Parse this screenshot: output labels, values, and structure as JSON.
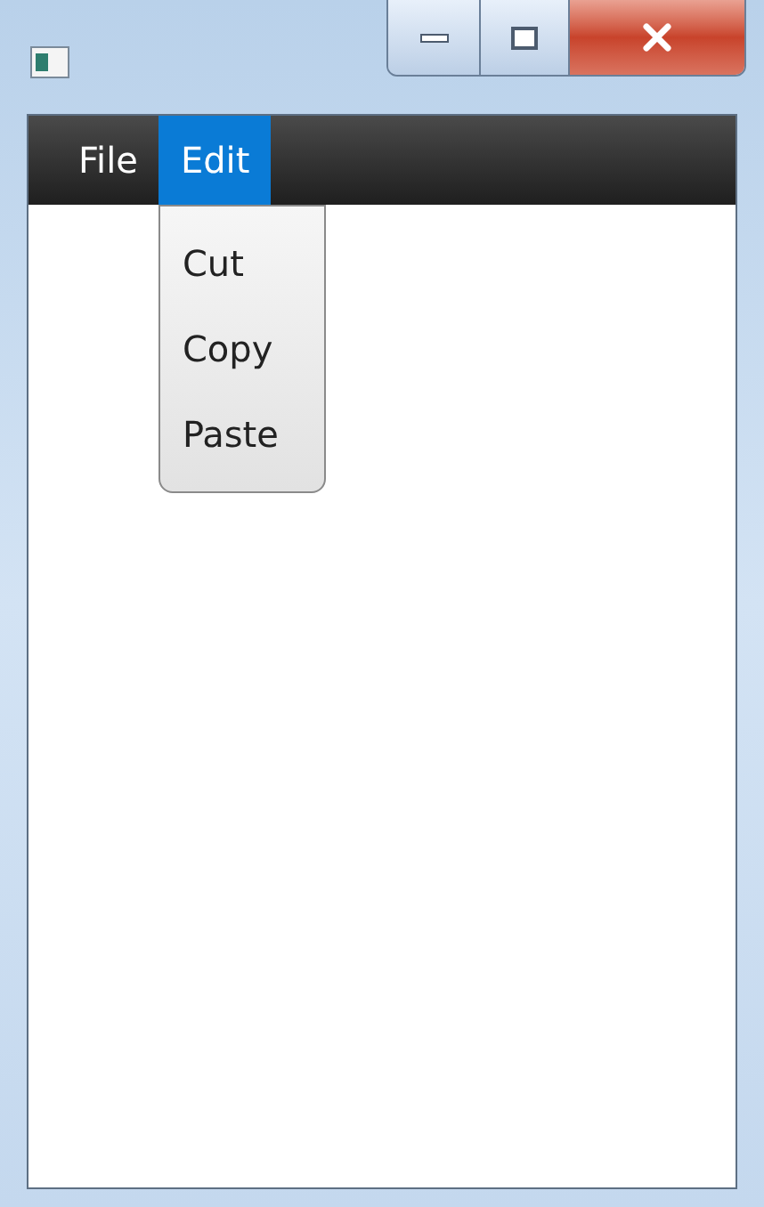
{
  "menu_bar": [
    {
      "label": "File",
      "selected": false
    },
    {
      "label": "Edit",
      "selected": true
    }
  ],
  "dropdown": {
    "items": [
      "Cut",
      "Copy",
      "Paste"
    ]
  }
}
